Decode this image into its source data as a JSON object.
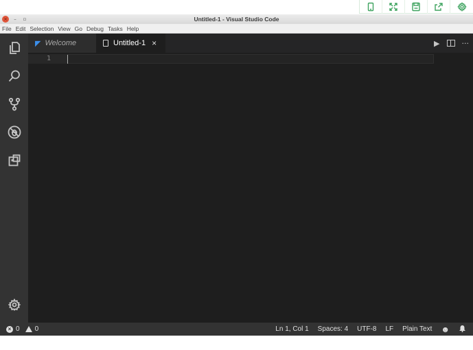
{
  "external_toolbar": {
    "icons": [
      "phone-icon",
      "fullscreen-icon",
      "save-icon",
      "share-icon",
      "gear-icon"
    ],
    "accent_color": "#3ea35f"
  },
  "window": {
    "title": "Untitled-1 - Visual Studio Code",
    "controls": {
      "close": "×",
      "minimize": "–",
      "maximize": "▫"
    }
  },
  "menubar": {
    "items": [
      "File",
      "Edit",
      "Selection",
      "View",
      "Go",
      "Debug",
      "Tasks",
      "Help"
    ]
  },
  "activitybar": {
    "icons": [
      "explorer-icon",
      "search-icon",
      "source-control-icon",
      "debug-icon",
      "extensions-icon"
    ],
    "settings_icon": "gear-icon"
  },
  "tabs": [
    {
      "label": "Welcome",
      "icon": "vscode-logo-icon",
      "active": false
    },
    {
      "label": "Untitled-1",
      "icon": "file-icon",
      "active": true,
      "close": "×"
    }
  ],
  "tab_actions": [
    "run-icon",
    "split-editor-icon",
    "more-icon"
  ],
  "tab_actions_glyphs": {
    "run": "▶",
    "more": "···"
  },
  "editor": {
    "line_numbers": [
      "1"
    ],
    "content": ""
  },
  "statusbar": {
    "errors": "0",
    "warnings": "0",
    "cursor_position": "Ln 1, Col 1",
    "indentation": "Spaces: 4",
    "encoding": "UTF-8",
    "line_ending": "LF",
    "language": "Plain Text",
    "icons": [
      "smiley-icon",
      "bell-icon"
    ]
  },
  "colors": {
    "editor_bg": "#1e1e1e",
    "activitybar_bg": "#333333",
    "statusbar_bg": "#333333",
    "tab_inactive_bg": "#2d2d2d"
  }
}
